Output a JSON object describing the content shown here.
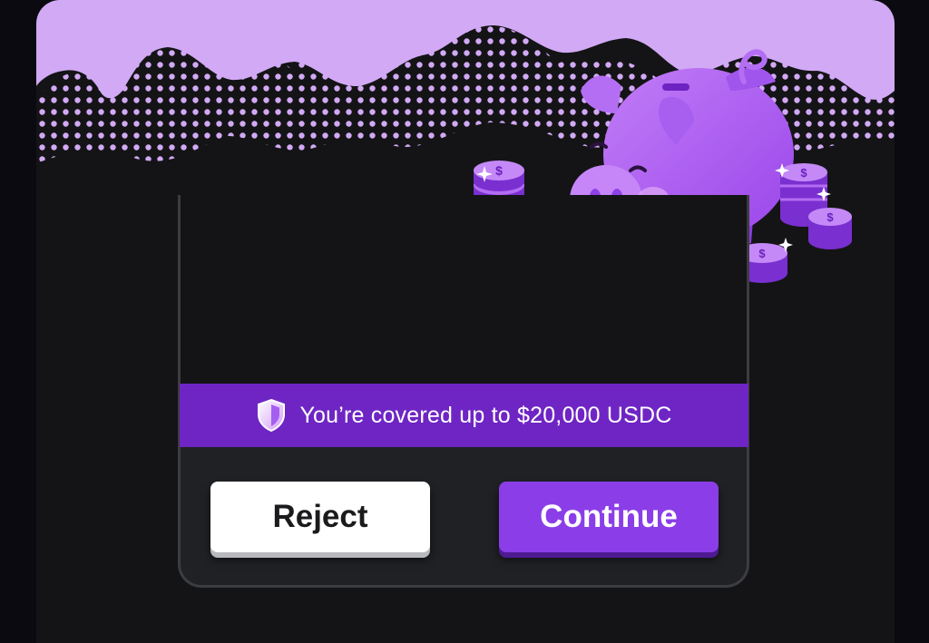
{
  "coverage": {
    "text": "You’re covered up to $20,000 USDC",
    "icon": "shield-icon"
  },
  "actions": {
    "reject_label": "Reject",
    "continue_label": "Continue"
  },
  "illustration": {
    "subject": "piggy-bank-icon",
    "coin_icon": "dollar-coin-icon"
  },
  "colors": {
    "brand_purple": "#8b3ee8",
    "banner_purple": "#6f25c4",
    "hero_lilac": "#d2a9f5",
    "background": "#141416"
  }
}
